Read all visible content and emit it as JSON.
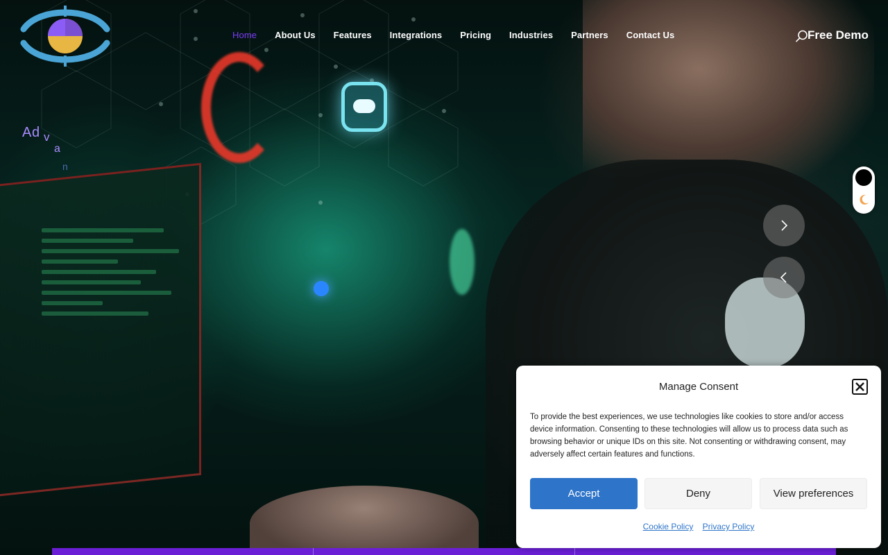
{
  "nav": {
    "items": [
      {
        "label": "Home",
        "active": true
      },
      {
        "label": "About Us",
        "active": false
      },
      {
        "label": "Features",
        "active": false
      },
      {
        "label": "Integrations",
        "active": false
      },
      {
        "label": "Pricing",
        "active": false
      },
      {
        "label": "Industries",
        "active": false
      },
      {
        "label": "Partners",
        "active": false
      },
      {
        "label": "Contact Us",
        "active": false
      }
    ],
    "cta_label": "Free Demo",
    "search_icon": "search-icon"
  },
  "hero": {
    "animated_text_letters": [
      "A",
      "d",
      "v",
      "a",
      "n"
    ]
  },
  "consent": {
    "title": "Manage Consent",
    "body": "To provide the best experiences, we use technologies like cookies to store and/or access device information. Consenting to these technologies will allow us to process data such as browsing behavior or unique IDs on this site. Not consenting or withdrawing consent, may adversely affect certain features and functions.",
    "accept_label": "Accept",
    "deny_label": "Deny",
    "preferences_label": "View preferences",
    "cookie_policy_label": "Cookie Policy",
    "privacy_policy_label": "Privacy Policy"
  },
  "colors": {
    "accent": "#7b3cf5",
    "button_primary": "#2e74c9",
    "bottom_bar": "#6a1fd6"
  }
}
